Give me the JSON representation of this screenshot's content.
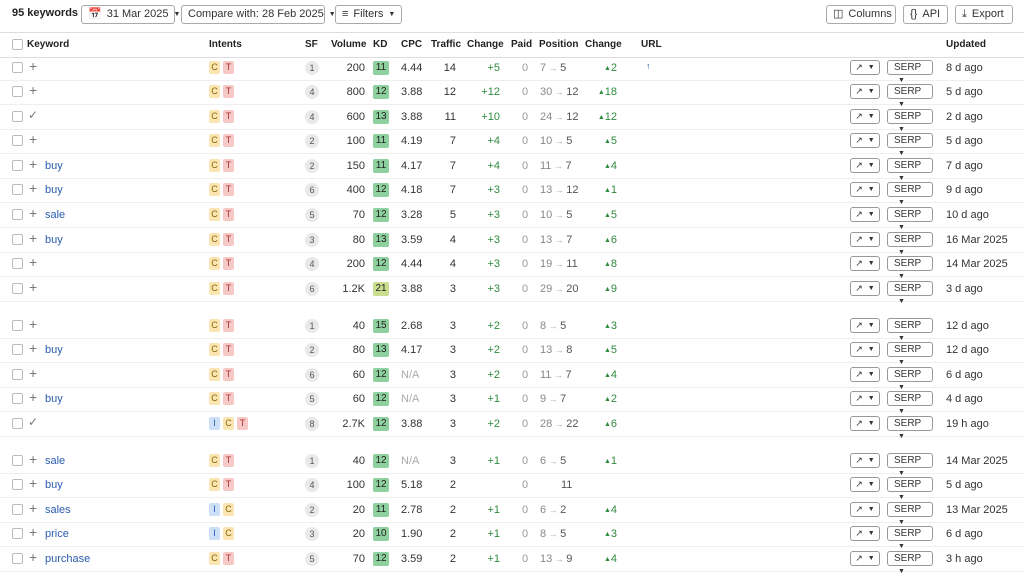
{
  "toolbar": {
    "keyword_count": "95 keywords",
    "date_label": "31 Mar 2025",
    "compare_label": "Compare with: 28 Feb 2025",
    "filters_label": "Filters",
    "columns_label": "Columns",
    "api_label": "API",
    "export_label": "Export"
  },
  "columns": {
    "keyword": "Keyword",
    "intents": "Intents",
    "sf": "SF",
    "volume": "Volume",
    "kd": "KD",
    "cpc": "CPC",
    "traffic": "Traffic",
    "change": "Change",
    "paid": "Paid",
    "position": "Position",
    "position_change": "Change",
    "url": "URL",
    "updated": "Updated"
  },
  "action": {
    "serp_label": "SERP"
  },
  "kd_colors": {
    "10": "#8fd19e",
    "11": "#8fd19e",
    "12": "#8fd19e",
    "13": "#8fd19e",
    "15": "#8fd19e",
    "21": "#c8dd8e"
  },
  "rows": [
    {
      "mark": "plus",
      "kw": "",
      "intents": [
        "C",
        "T"
      ],
      "sf": "1",
      "volume": "200",
      "kd": "11",
      "cpc": "4.44",
      "traffic": "14",
      "change": "+5",
      "paid": "0",
      "from": "7",
      "to": "5",
      "pchange": "2",
      "url": "↑",
      "updated": "8 d ago"
    },
    {
      "mark": "plus",
      "kw": "",
      "intents": [
        "C",
        "T"
      ],
      "sf": "4",
      "volume": "800",
      "kd": "12",
      "cpc": "3.88",
      "traffic": "12",
      "change": "+12",
      "paid": "0",
      "from": "30",
      "to": "12",
      "pchange": "18",
      "url": "",
      "updated": "5 d ago"
    },
    {
      "mark": "check",
      "kw": "",
      "intents": [
        "C",
        "T"
      ],
      "sf": "4",
      "volume": "600",
      "kd": "13",
      "cpc": "3.88",
      "traffic": "11",
      "change": "+10",
      "paid": "0",
      "from": "24",
      "to": "12",
      "pchange": "12",
      "url": "",
      "updated": "2 d ago"
    },
    {
      "mark": "plus",
      "kw": "",
      "intents": [
        "C",
        "T"
      ],
      "sf": "2",
      "volume": "100",
      "kd": "11",
      "cpc": "4.19",
      "traffic": "7",
      "change": "+4",
      "paid": "0",
      "from": "10",
      "to": "5",
      "pchange": "5",
      "url": "",
      "updated": "5 d ago"
    },
    {
      "mark": "plus",
      "kw": "buy",
      "intents": [
        "C",
        "T"
      ],
      "sf": "2",
      "volume": "150",
      "kd": "11",
      "cpc": "4.17",
      "traffic": "7",
      "change": "+4",
      "paid": "0",
      "from": "11",
      "to": "7",
      "pchange": "4",
      "url": "",
      "updated": "7 d ago"
    },
    {
      "mark": "plus",
      "kw": "buy",
      "intents": [
        "C",
        "T"
      ],
      "sf": "6",
      "volume": "400",
      "kd": "12",
      "cpc": "4.18",
      "traffic": "7",
      "change": "+3",
      "paid": "0",
      "from": "13",
      "to": "12",
      "pchange": "1",
      "url": "",
      "updated": "9 d ago"
    },
    {
      "mark": "plus",
      "kw": "sale",
      "intents": [
        "C",
        "T"
      ],
      "sf": "5",
      "volume": "70",
      "kd": "12",
      "cpc": "3.28",
      "traffic": "5",
      "change": "+3",
      "paid": "0",
      "from": "10",
      "to": "5",
      "pchange": "5",
      "url": "",
      "updated": "10 d ago"
    },
    {
      "mark": "plus",
      "kw": "buy",
      "intents": [
        "C",
        "T"
      ],
      "sf": "3",
      "volume": "80",
      "kd": "13",
      "cpc": "3.59",
      "traffic": "4",
      "change": "+3",
      "paid": "0",
      "from": "13",
      "to": "7",
      "pchange": "6",
      "url": "",
      "updated": "16 Mar 2025"
    },
    {
      "mark": "plus",
      "kw": "",
      "intents": [
        "C",
        "T"
      ],
      "sf": "4",
      "volume": "200",
      "kd": "12",
      "cpc": "4.44",
      "traffic": "4",
      "change": "+3",
      "paid": "0",
      "from": "19",
      "to": "11",
      "pchange": "8",
      "url": "",
      "updated": "14 Mar 2025"
    },
    {
      "mark": "plus",
      "kw": "",
      "intents": [
        "C",
        "T"
      ],
      "sf": "6",
      "volume": "1.2K",
      "kd": "21",
      "cpc": "3.88",
      "traffic": "3",
      "change": "+3",
      "paid": "0",
      "from": "29",
      "to": "20",
      "pchange": "9",
      "url": "",
      "updated": "3 d ago"
    },
    {
      "mark": "plus",
      "kw": "",
      "intents": [
        "C",
        "T"
      ],
      "sf": "1",
      "volume": "40",
      "kd": "15",
      "cpc": "2.68",
      "traffic": "3",
      "change": "+2",
      "paid": "0",
      "from": "8",
      "to": "5",
      "pchange": "3",
      "url": "",
      "updated": "12 d ago"
    },
    {
      "mark": "plus",
      "kw": "buy",
      "intents": [
        "C",
        "T"
      ],
      "sf": "2",
      "volume": "80",
      "kd": "13",
      "cpc": "4.17",
      "traffic": "3",
      "change": "+2",
      "paid": "0",
      "from": "13",
      "to": "8",
      "pchange": "5",
      "url": "",
      "updated": "12 d ago"
    },
    {
      "mark": "plus",
      "kw": "",
      "intents": [
        "C",
        "T"
      ],
      "sf": "6",
      "volume": "60",
      "kd": "12",
      "cpc": "N/A",
      "traffic": "3",
      "change": "+2",
      "paid": "0",
      "from": "11",
      "to": "7",
      "pchange": "4",
      "url": "",
      "updated": "6 d ago"
    },
    {
      "mark": "plus",
      "kw": "buy",
      "intents": [
        "C",
        "T"
      ],
      "sf": "5",
      "volume": "60",
      "kd": "12",
      "cpc": "N/A",
      "traffic": "3",
      "change": "+1",
      "paid": "0",
      "from": "9",
      "to": "7",
      "pchange": "2",
      "url": "",
      "updated": "4 d ago"
    },
    {
      "mark": "check",
      "kw": "",
      "intents": [
        "I",
        "C",
        "T"
      ],
      "sf": "8",
      "volume": "2.7K",
      "kd": "12",
      "cpc": "3.88",
      "traffic": "3",
      "change": "+2",
      "paid": "0",
      "from": "28",
      "to": "22",
      "pchange": "6",
      "url": "",
      "updated": "19 h ago"
    },
    {
      "mark": "plus",
      "kw": "sale",
      "intents": [
        "C",
        "T"
      ],
      "sf": "1",
      "volume": "40",
      "kd": "12",
      "cpc": "N/A",
      "traffic": "3",
      "change": "+1",
      "paid": "0",
      "from": "6",
      "to": "5",
      "pchange": "1",
      "url": "",
      "updated": "14 Mar 2025"
    },
    {
      "mark": "plus",
      "kw": "buy",
      "intents": [
        "C",
        "T"
      ],
      "sf": "4",
      "volume": "100",
      "kd": "12",
      "cpc": "5.18",
      "traffic": "2",
      "change": "",
      "paid": "0",
      "from": "",
      "to": "11",
      "pchange": "",
      "url": "",
      "updated": "5 d ago"
    },
    {
      "mark": "plus",
      "kw": "sales",
      "intents": [
        "I",
        "C"
      ],
      "sf": "2",
      "volume": "20",
      "kd": "11",
      "cpc": "2.78",
      "traffic": "2",
      "change": "+1",
      "paid": "0",
      "from": "6",
      "to": "2",
      "pchange": "4",
      "url": "",
      "updated": "13 Mar 2025"
    },
    {
      "mark": "plus",
      "kw": "price",
      "intents": [
        "I",
        "C"
      ],
      "sf": "3",
      "volume": "20",
      "kd": "10",
      "cpc": "1.90",
      "traffic": "2",
      "change": "+1",
      "paid": "0",
      "from": "8",
      "to": "5",
      "pchange": "3",
      "url": "",
      "updated": "6 d ago"
    },
    {
      "mark": "plus",
      "kw": "purchase",
      "intents": [
        "C",
        "T"
      ],
      "sf": "5",
      "volume": "70",
      "kd": "12",
      "cpc": "3.59",
      "traffic": "2",
      "change": "+1",
      "paid": "0",
      "from": "13",
      "to": "9",
      "pchange": "4",
      "url": "",
      "updated": "3 h ago"
    }
  ]
}
